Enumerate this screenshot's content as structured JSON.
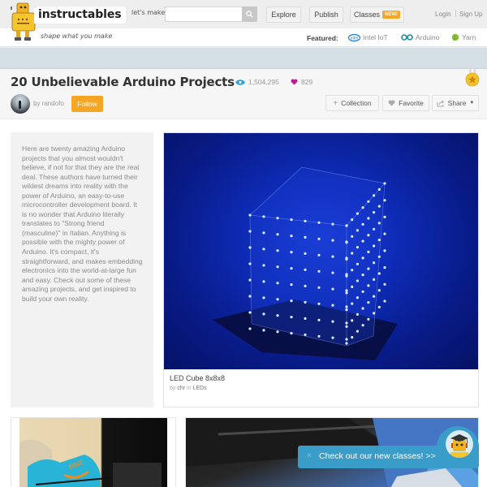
{
  "header": {
    "logo_text": "instructables",
    "tagline": "shape what you make",
    "lets_make_label": "let's make",
    "search": {
      "value": "",
      "placeholder": ""
    },
    "nav": {
      "explore": "Explore",
      "publish": "Publish",
      "classes": "Classes",
      "classes_badge": "NEW!"
    },
    "login": "Login",
    "signup": "Sign Up",
    "featured_label": "Featured:",
    "featured": [
      {
        "label": "Intel IoT",
        "icon": "intel-icon"
      },
      {
        "label": "Arduino",
        "icon": "arduino-icon"
      },
      {
        "label": "Yarn",
        "icon": "yarn-icon"
      }
    ]
  },
  "collection": {
    "title": "20 Unbelievable Arduino Projects",
    "views": "1,504,295",
    "favorites": "829",
    "author_prefix": "by",
    "author": "randofo",
    "follow_label": "Follow",
    "actions": {
      "collection": "Collection",
      "favorite": "Favorite",
      "share": "Share"
    },
    "description": "Here are twenty amazing Arduino projects that you almost wouldn't believe, if not for that they are the real deal. These authors have turned their wildest dreams into reality with the power of Arduino, an easy-to-use microcontroller development board. It is no wonder that Arduino literally translates to \"Strong friend (masculine)\" in Italian. Anything is possible with the mighty power of Arduino. It's compact, it's straightforward, and makes embedding electronics into the world-at-large fun and easy. Check out some of these amazing projects, and get inspired to build your own reality."
  },
  "featured_project": {
    "title": "LED Cube 8x8x8",
    "by_prefix": "by",
    "author": "chr",
    "in_prefix": "in",
    "category": "LEDs"
  },
  "toast": {
    "close": "×",
    "text": "Check out our new classes! >>"
  },
  "colors": {
    "accent_orange": "#f6a623",
    "toast_blue": "#3a9cc8",
    "views_blue": "#2aa3d9",
    "favorite_magenta": "#c2188f",
    "strip_blue": "#d4e0e6"
  }
}
